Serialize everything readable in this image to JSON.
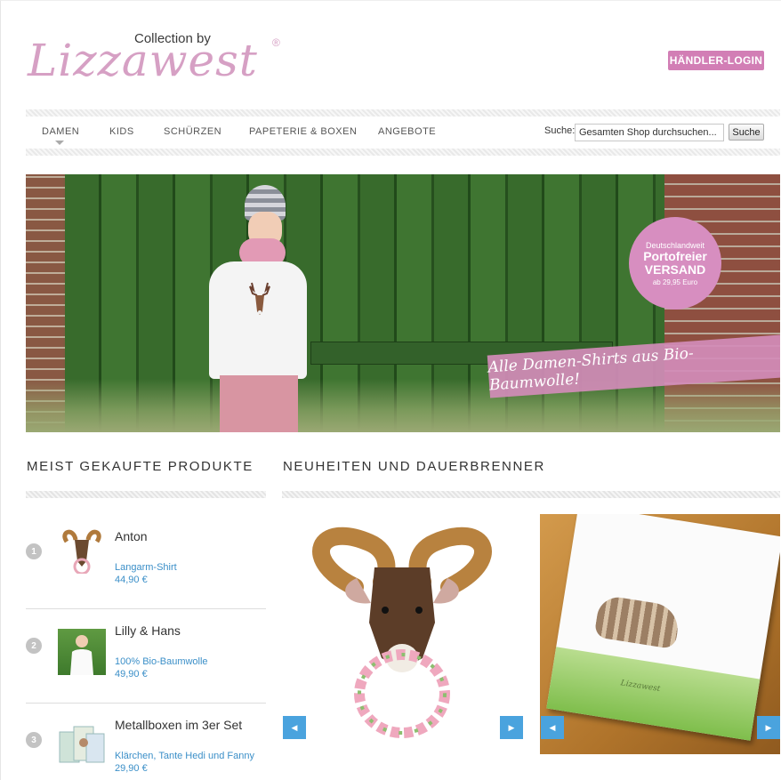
{
  "header": {
    "logo_small": "Collection by",
    "logo_main": "Lizzawest",
    "logo_reg": "®",
    "dealer_login": "HÄNDLER-LOGIN"
  },
  "nav": {
    "items": [
      "DAMEN",
      "KIDS",
      "SCHÜRZEN",
      "PAPETERIE & BOXEN",
      "ANGEBOTE"
    ],
    "search_label": "Suche:",
    "search_placeholder": "Gesamten Shop durchsuchen...",
    "search_button": "Suche"
  },
  "hero": {
    "badge_line1": "Deutschlandweit",
    "badge_line2": "Portofreier",
    "badge_line3": "VERSAND",
    "badge_line4": "ab 29,95 Euro",
    "script_banner": "Alle Damen-Shirts aus Bio-Baumwolle!",
    "shirt_icon": "deer-icon"
  },
  "sections": {
    "bestsellers_title": "MEIST GEKAUFTE PRODUKTE",
    "new_title": "NEUHEITEN UND DAUERBRENNER"
  },
  "bestsellers": [
    {
      "rank": "1",
      "name": "Anton",
      "sub": "Langarm-Shirt",
      "price": "44,90 €"
    },
    {
      "rank": "2",
      "name": "Lilly & Hans",
      "sub": "100% Bio-Baumwolle",
      "price": "49,90 €"
    },
    {
      "rank": "3",
      "name": "Metallboxen im 3er Set",
      "sub": "Klärchen, Tante Hedi und Fanny",
      "price": "29,90 €"
    }
  ],
  "carousel": {
    "prev_icon": "arrow-left-icon",
    "next_icon": "arrow-right-icon",
    "note_brand": "Lizzawest"
  },
  "colors": {
    "brand_pink": "#d27eb5",
    "link_blue": "#3b8fc8",
    "arrow_blue": "#4aa3de"
  }
}
